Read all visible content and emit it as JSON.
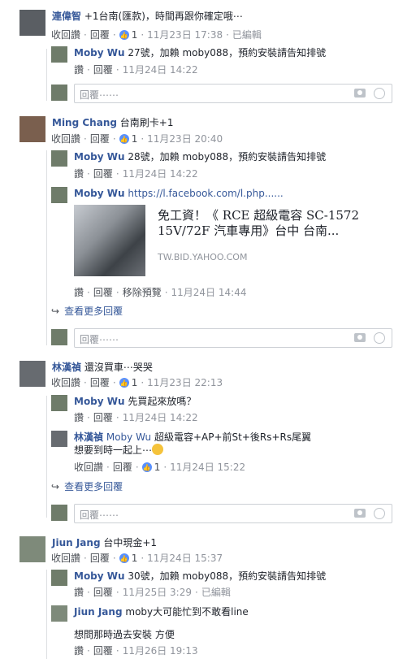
{
  "actions": {
    "reply_back": "回覆",
    "unlike": "收回讚",
    "like": "讚",
    "edited": "已編輯",
    "remove_preview": "移除預覽",
    "view_more": "查看更多回覆",
    "reply_placeholder": "回覆⋯⋯"
  },
  "c1": {
    "author": "連偉智",
    "text": "+1台南(匯款)，時間再跟你確定哦⋯",
    "likes": "1",
    "time": "11月23日 17:38",
    "r1": {
      "author": "Moby Wu",
      "text": "27號，加賴 moby088，預約安裝請告知排號",
      "time": "11月24日 14:22"
    }
  },
  "c2": {
    "author": "Ming Chang",
    "text": "台南刷卡+1",
    "likes": "1",
    "time": "11月23日 20:40",
    "r1": {
      "author": "Moby Wu",
      "text": "28號，加賴 moby088，預約安裝請告知排號",
      "time": "11月24日 14:22"
    },
    "r2": {
      "author": "Moby Wu",
      "text": "https://l.facebook.com/l.php......",
      "time": "11月24日 14:44",
      "preview_title": "免工資！《 RCE 超級電容 SC-1572 15V/72F 汽車專用》台中 台南...",
      "preview_domain": "TW.BID.YAHOO.COM"
    }
  },
  "c3": {
    "author": "林漢禎",
    "text": "還沒買車⋯哭哭",
    "likes": "1",
    "time": "11月23日 22:13",
    "r1": {
      "author": "Moby Wu",
      "text": "先買起來放嗎？",
      "time": "11月24日 14:22"
    },
    "r2": {
      "author1": "林漢禎",
      "author2": "Moby Wu",
      "text": "超級電容+AP+前St+後Rs+Rs尾翼",
      "text2": "想要到時一起上⋯",
      "likes": "1",
      "time": "11月24日 15:22"
    }
  },
  "c4": {
    "author": "Jiun Jang",
    "text": "台中現金+1",
    "likes": "1",
    "time": "11月24日 15:37",
    "r1": {
      "author": "Moby Wu",
      "text": "30號，加賴 moby088，預約安裝請告知排號",
      "time": "11月25日 3:29"
    },
    "r2": {
      "author": "Jiun Jang",
      "text": "moby大可能忙到不敢看line",
      "text2": "想問那時過去安裝 方便",
      "time": "11月26日 19:13"
    }
  }
}
